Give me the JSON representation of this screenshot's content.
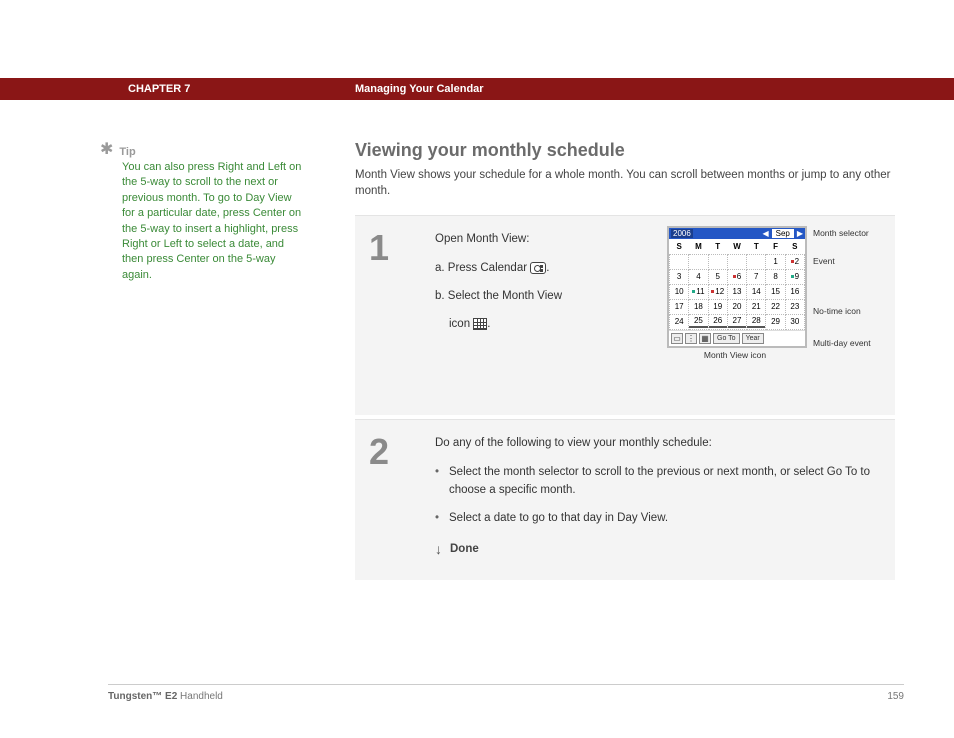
{
  "header": {
    "chapter_label": "CHAPTER 7",
    "chapter_title": "Managing Your Calendar"
  },
  "tip": {
    "star": "✱",
    "heading": "Tip",
    "body": "You can also press Right and Left on the 5-way to scroll to the next or previous month. To go to Day View for a particular date, press Center on the 5-way to insert a highlight, press Right or Left to select a date, and then press Center on the 5-way again."
  },
  "section": {
    "title": "Viewing your monthly schedule",
    "intro": "Month View shows your schedule for a whole month. You can scroll between months or jump to any other month."
  },
  "step1": {
    "num": "1",
    "lead": "Open Month View:",
    "a_prefix": "a.  Press Calendar ",
    "a_suffix": ".",
    "b_prefix": "b.  Select the Month View",
    "b_line2_prefix": "icon ",
    "b_suffix": "."
  },
  "calendar": {
    "year": "2006",
    "month": "Sep",
    "left_arrow": "◀",
    "right_arrow": "▶",
    "dow": [
      "S",
      "M",
      "T",
      "W",
      "T",
      "F",
      "S"
    ],
    "rows": [
      [
        "",
        "",
        "",
        "",
        "",
        "1",
        "2"
      ],
      [
        "3",
        "4",
        "5",
        "6",
        "7",
        "8",
        "9"
      ],
      [
        "10",
        "11",
        "12",
        "13",
        "14",
        "15",
        "16"
      ],
      [
        "17",
        "18",
        "19",
        "20",
        "21",
        "22",
        "23"
      ],
      [
        "24",
        "25",
        "26",
        "27",
        "28",
        "29",
        "30"
      ]
    ],
    "buttons": {
      "goto": "Go To",
      "year": "Year"
    },
    "callouts": {
      "month_selector": "Month selector",
      "event": "Event",
      "notime": "No-time icon",
      "multiday": "Multi-day event",
      "mv_icon": "Month View icon"
    }
  },
  "step2": {
    "num": "2",
    "lead": "Do any of the following to view your monthly schedule:",
    "b1": "Select the month selector to scroll to the previous or next month, or select Go To to choose a specific month.",
    "b2": "Select a date to go to that day in Day View.",
    "done_arrow": "↓",
    "done": "Done"
  },
  "footer": {
    "product_bold": "Tungsten™ E2",
    "product_rest": " Handheld",
    "page": "159"
  }
}
